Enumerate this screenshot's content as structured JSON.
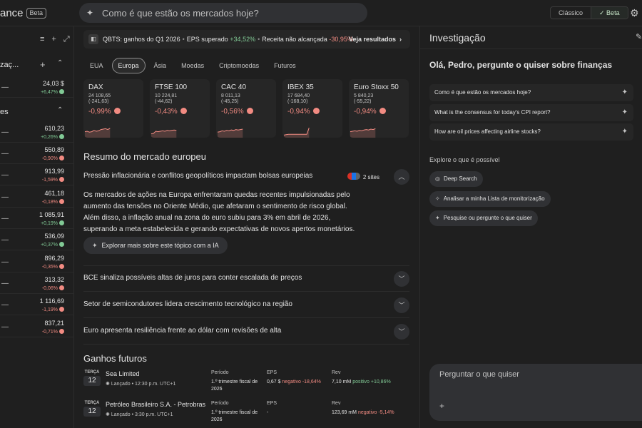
{
  "header": {
    "logo_text": "ance",
    "logo_badge": "Beta",
    "search_placeholder": "Como é que estão os mercados hoje?",
    "view_classic": "Clássico",
    "view_beta": "✓ Beta"
  },
  "leftbar": {
    "section1": "zaç...",
    "section2": "es",
    "rows": [
      {
        "price": "24,03 $",
        "change": "+6,47%",
        "dir": "pos"
      },
      {
        "price": "610,23",
        "change": "+0,26%",
        "dir": "pos"
      },
      {
        "price": "550,89",
        "change": "-0,90%",
        "dir": "neg"
      },
      {
        "price": "913,99",
        "change": "-1,59%",
        "dir": "neg"
      },
      {
        "price": "461,18",
        "change": "-0,18%",
        "dir": "neg"
      },
      {
        "price": "1 085,91",
        "change": "+0,19%",
        "dir": "pos"
      },
      {
        "price": "536,09",
        "change": "+0,37%",
        "dir": "pos"
      },
      {
        "price": "896,29",
        "change": "-0,35%",
        "dir": "neg"
      },
      {
        "price": "313,32",
        "change": "-0,06%",
        "dir": "neg"
      },
      {
        "price": "1 116,69",
        "change": "-1,19%",
        "dir": "neg"
      },
      {
        "price": "837,21",
        "change": "-0,71%",
        "dir": "neg"
      }
    ]
  },
  "ticker": {
    "headline": "QBTS: ganhos do Q1 2026",
    "eps_label": "EPS superado",
    "eps_value": "+34,52%",
    "rev_label": "Receita não alcançada",
    "rev_value": "-30,95%",
    "link": "Veja resultados"
  },
  "tabs": [
    "EUA",
    "Europa",
    "Ásia",
    "Moedas",
    "Criptomoedas",
    "Futuros"
  ],
  "indices": [
    {
      "name": "DAX",
      "value": "24 108,65",
      "change": "(-241,63)",
      "pct": "-0,99%",
      "spark": [
        0.55,
        0.5,
        0.6,
        0.55,
        0.4,
        0.5,
        0.45,
        0.3,
        0.25,
        0.2,
        0.3,
        0.15
      ]
    },
    {
      "name": "FTSE 100",
      "value": "10 224,81",
      "change": "(-44,62)",
      "pct": "-0,43%",
      "spark": [
        0.8,
        0.75,
        0.5,
        0.55,
        0.5,
        0.45,
        0.5,
        0.4,
        0.45,
        0.4,
        0.35,
        0.4
      ]
    },
    {
      "name": "CAC 40",
      "value": "8 011,13",
      "change": "(-45,25)",
      "pct": "-0,56%",
      "spark": [
        0.6,
        0.55,
        0.45,
        0.5,
        0.4,
        0.45,
        0.35,
        0.4,
        0.3,
        0.35,
        0.3,
        0.25
      ]
    },
    {
      "name": "IBEX 35",
      "value": "17 684,40",
      "change": "(-168,10)",
      "pct": "-0,94%",
      "spark": [
        0.95,
        0.9,
        0.85,
        0.85,
        0.85,
        0.85,
        0.85,
        0.85,
        0.85,
        0.85,
        0.85,
        0.1
      ]
    },
    {
      "name": "Euro Stoxx 50",
      "value": "5 840,23",
      "change": "(-55,22)",
      "pct": "-0,94%",
      "spark": [
        0.55,
        0.5,
        0.45,
        0.5,
        0.4,
        0.45,
        0.35,
        0.3,
        0.35,
        0.25,
        0.3,
        0.2
      ]
    }
  ],
  "summary": {
    "title": "Resumo do mercado europeu",
    "expanded_title": "Pressão inflacionária e conflitos geopolíticos impactam bolsas europeias",
    "sites": "2 sites",
    "body": "Os mercados de ações na Europa enfrentaram quedas recentes impulsionadas pelo aumento das tensões no Oriente Médio, que afetaram o sentimento de risco global. Além disso, a inflação anual na zona do euro subiu para 3% em abril de 2026, superando a meta estabelecida e gerando expectativas de novos apertos monetários.",
    "ai_button": "Explorar mais sobre este tópico com a IA",
    "collapsed": [
      "BCE sinaliza possíveis altas de juros para conter escalada de preços",
      "Setor de semicondutores lidera crescimento tecnológico na região",
      "Euro apresenta resiliência frente ao dólar com revisões de alta"
    ]
  },
  "earnings": {
    "title": "Ganhos futuros",
    "period_label": "Período",
    "eps_label": "EPS",
    "rev_label": "Rev",
    "rows": [
      {
        "day": "TERÇA",
        "date": "12",
        "company": "Sea Limited",
        "sub": "Lançado • 12:30 p.m. UTC+1",
        "period": "1.º trimestre fiscal de 2026",
        "eps": "0,67 $",
        "eps_note": "negativo -18,64%",
        "rev": "7,10 mM",
        "rev_note": "positivo +10,86%"
      },
      {
        "day": "TERÇA",
        "date": "12",
        "company": "Petróleo Brasileiro S.A. - Petrobras",
        "sub": "Lançado • 3:30 p.m. UTC+1",
        "period": "1.º trimestre fiscal de 2026",
        "eps": "-",
        "eps_note": "",
        "rev": "123,69 mM",
        "rev_note": "negativo -5,14%"
      }
    ]
  },
  "panel": {
    "title": "Investigação",
    "greeting": "Olá, Pedro, pergunte o quiser sobre finanças",
    "suggestions": [
      "Como é que estão os mercados hoje?",
      "What is the consensus for today's CPI report?",
      "How are oil prices affecting airline stocks?"
    ],
    "explore_label": "Explore o que é possível",
    "chips": [
      "Deep Search",
      "Analisar a minha Lista de monitorização",
      "Pesquise ou pergunte o que quiser"
    ],
    "ask_placeholder": "Perguntar o que quiser"
  }
}
